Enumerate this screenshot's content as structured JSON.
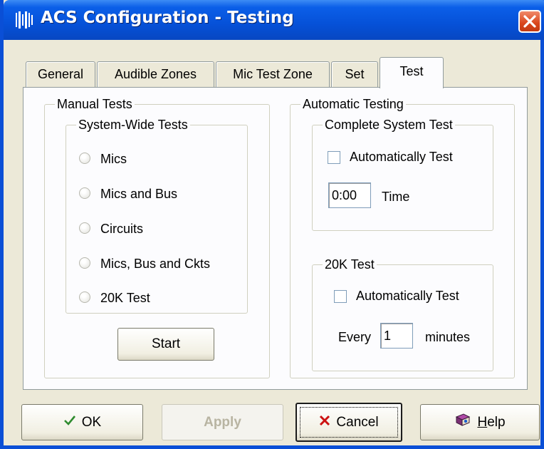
{
  "window": {
    "title": "ACS Configuration - Testing"
  },
  "tabs": [
    {
      "label": "General",
      "active": false
    },
    {
      "label": "Audible Zones",
      "active": false
    },
    {
      "label": "Mic Test Zone",
      "active": false
    },
    {
      "label": "Set",
      "active": false
    },
    {
      "label": "Test",
      "active": true
    }
  ],
  "manual_tests": {
    "title": "Manual Tests",
    "system_wide": {
      "title": "System-Wide Tests",
      "options": [
        "Mics",
        "Mics and Bus",
        "Circuits",
        "Mics, Bus and Ckts",
        "20K Test"
      ]
    },
    "start_label": "Start"
  },
  "automatic_testing": {
    "title": "Automatic Testing",
    "complete_system_test": {
      "title": "Complete System Test",
      "auto_label": "Automatically Test",
      "auto_checked": false,
      "time_value": "0:00",
      "time_label": "Time"
    },
    "test_20k": {
      "title": "20K Test",
      "auto_label": "Automatically Test",
      "auto_checked": false,
      "every_label": "Every",
      "every_value": "1",
      "minutes_label": "minutes"
    }
  },
  "buttons": {
    "ok": "OK",
    "apply": "Apply",
    "cancel": "Cancel",
    "help_accel": "H",
    "help_rest": "elp"
  },
  "icons": {
    "app": "barcode-speaker-icon",
    "close": "close-icon",
    "ok": "checkmark-icon",
    "cancel": "x-mark-icon",
    "help": "help-book-icon"
  },
  "colors": {
    "titlebar": "#0651d8",
    "close": "#d9461c",
    "ok_check": "#2e8b2e",
    "cancel_x": "#cc1111"
  }
}
